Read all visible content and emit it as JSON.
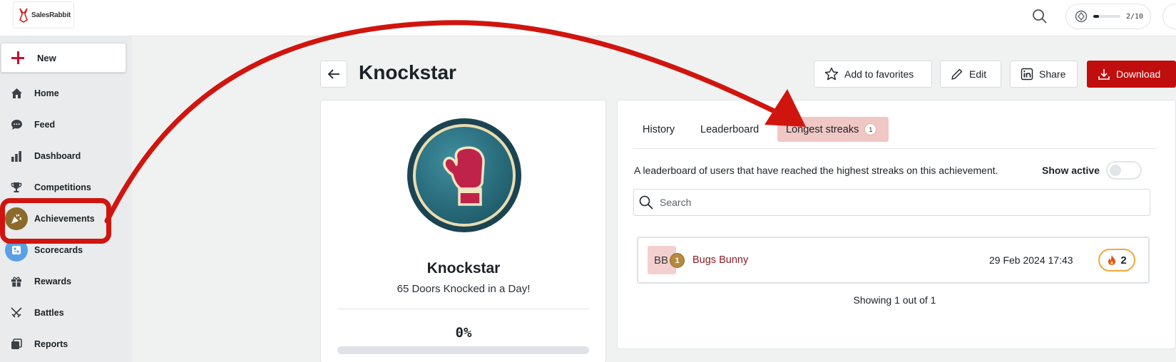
{
  "app": {
    "logo_text": "SalesRabbit"
  },
  "topbar": {
    "progress_text": "2/10",
    "progress_fraction": 0.2
  },
  "sidebar": {
    "new_label": "New",
    "items": [
      {
        "label": "Home",
        "icon": "home-icon"
      },
      {
        "label": "Feed",
        "icon": "chat-bubble-icon"
      },
      {
        "label": "Dashboard",
        "icon": "bar-chart-icon"
      },
      {
        "label": "Competitions",
        "icon": "trophy-icon"
      },
      {
        "label": "Achievements",
        "icon": "party-popper-icon",
        "active": true
      },
      {
        "label": "Scorecards",
        "icon": "scorecard-icon"
      },
      {
        "label": "Rewards",
        "icon": "gift-icon"
      },
      {
        "label": "Battles",
        "icon": "crossed-swords-icon"
      },
      {
        "label": "Reports",
        "icon": "reports-icon"
      }
    ]
  },
  "header": {
    "title": "Knockstar",
    "buttons": {
      "favorites": "Add to favorites",
      "edit": "Edit",
      "share": "Share",
      "download": "Download"
    }
  },
  "achievement": {
    "name": "Knockstar",
    "description": "65 Doors Knocked in a Day!",
    "progress_text": "0%",
    "progress_fraction": 0
  },
  "panel": {
    "tabs": [
      {
        "label": "History"
      },
      {
        "label": "Leaderboard"
      },
      {
        "label": "Longest streaks",
        "count": "1",
        "active": true
      }
    ],
    "description": "A leaderboard of users that have reached the highest streaks on this achievement.",
    "show_active_label": "Show active",
    "show_active_on": false,
    "search_placeholder": "Search",
    "rows": [
      {
        "initials": "BB",
        "rank": "1",
        "name": "Bugs Bunny",
        "date": "29 Feb 2024 17:43",
        "streak": "2"
      }
    ],
    "footer": "Showing 1 out of 1"
  },
  "colors": {
    "brand_red": "#c00d0d",
    "active_tab_bg": "#efc7c4",
    "annotation_red": "#d0150e",
    "streak_border": "#f4a63b"
  }
}
